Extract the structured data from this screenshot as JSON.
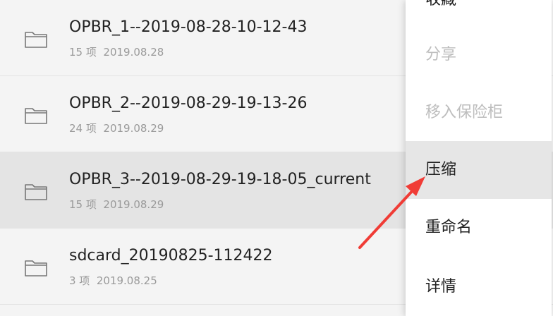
{
  "files": [
    {
      "name": "OPBR_1--2019-08-28-10-12-43",
      "count": "15 项",
      "date": "2019.08.28"
    },
    {
      "name": "OPBR_2--2019-08-29-19-13-26",
      "count": "24 项",
      "date": "2019.08.29"
    },
    {
      "name": "OPBR_3--2019-08-29-19-18-05_current",
      "count": "15 项",
      "date": "2019.08.29"
    },
    {
      "name": "sdcard_20190825-112422",
      "count": "3 项",
      "date": "2019.08.25"
    }
  ],
  "menu": {
    "items": [
      {
        "label": "收藏",
        "state": "enabled"
      },
      {
        "label": "分享",
        "state": "disabled"
      },
      {
        "label": "移入保险柜",
        "state": "disabled"
      },
      {
        "label": "压缩",
        "state": "highlighted"
      },
      {
        "label": "重命名",
        "state": "enabled"
      },
      {
        "label": "详情",
        "state": "enabled"
      }
    ]
  },
  "colors": {
    "list_background": "#f4f4f4",
    "selected_row": "#e4e4e4",
    "menu_background": "#ffffff",
    "disabled_text": "#bdbdbd",
    "annotation_arrow": "#f03c36"
  },
  "icons": {
    "file_row": "folder-icon",
    "annotation": "red-arrow-pointer"
  }
}
